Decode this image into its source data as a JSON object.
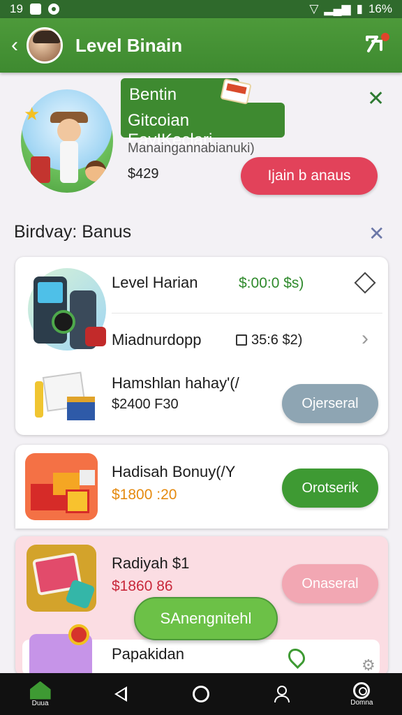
{
  "status_bar": {
    "time": "19",
    "battery": "16%"
  },
  "app_bar": {
    "title": "Level Binain",
    "back_icon": "arrow-left-icon",
    "action_icon": "share-icon"
  },
  "hero": {
    "name": "Bentin",
    "subtitle": "Gitcoian EayIKeclari",
    "description": "Manaingannabianuki)",
    "price": "$429",
    "button_label": "Ijain b anaus",
    "close_icon": "close-icon"
  },
  "section": {
    "title": "Birdvay: Banus",
    "close_icon": "close-icon"
  },
  "items": [
    {
      "name": "Level Harian",
      "amount": "$:00:0 $s)",
      "trailing_icon": "diamond-icon"
    },
    {
      "name": "Miadnurdopp",
      "amount": "35:6 $2)",
      "trailing_icon": "chevron-right-icon"
    },
    {
      "name": "Hamshlan hahay'(/",
      "price": "$2400 F30",
      "button": "Ojerseral"
    },
    {
      "name": "Hadisah Bonuy(/Y",
      "price": "$1800 :20",
      "button": "Orotserik"
    },
    {
      "name": "Radiyah $1",
      "price": "$1860 86",
      "button": "Onaseral"
    },
    {
      "name": "Papakidan"
    }
  ],
  "floating_button": "SAnengnitehl",
  "nav": {
    "home_label": "Duua",
    "profile_label": "Domna"
  },
  "colors": {
    "primary_green": "#3e8a30",
    "accent_red": "#e2425a",
    "button_green": "#3e9a33",
    "button_gray": "#8ea5b3",
    "button_pink": "#f2a7b3"
  }
}
